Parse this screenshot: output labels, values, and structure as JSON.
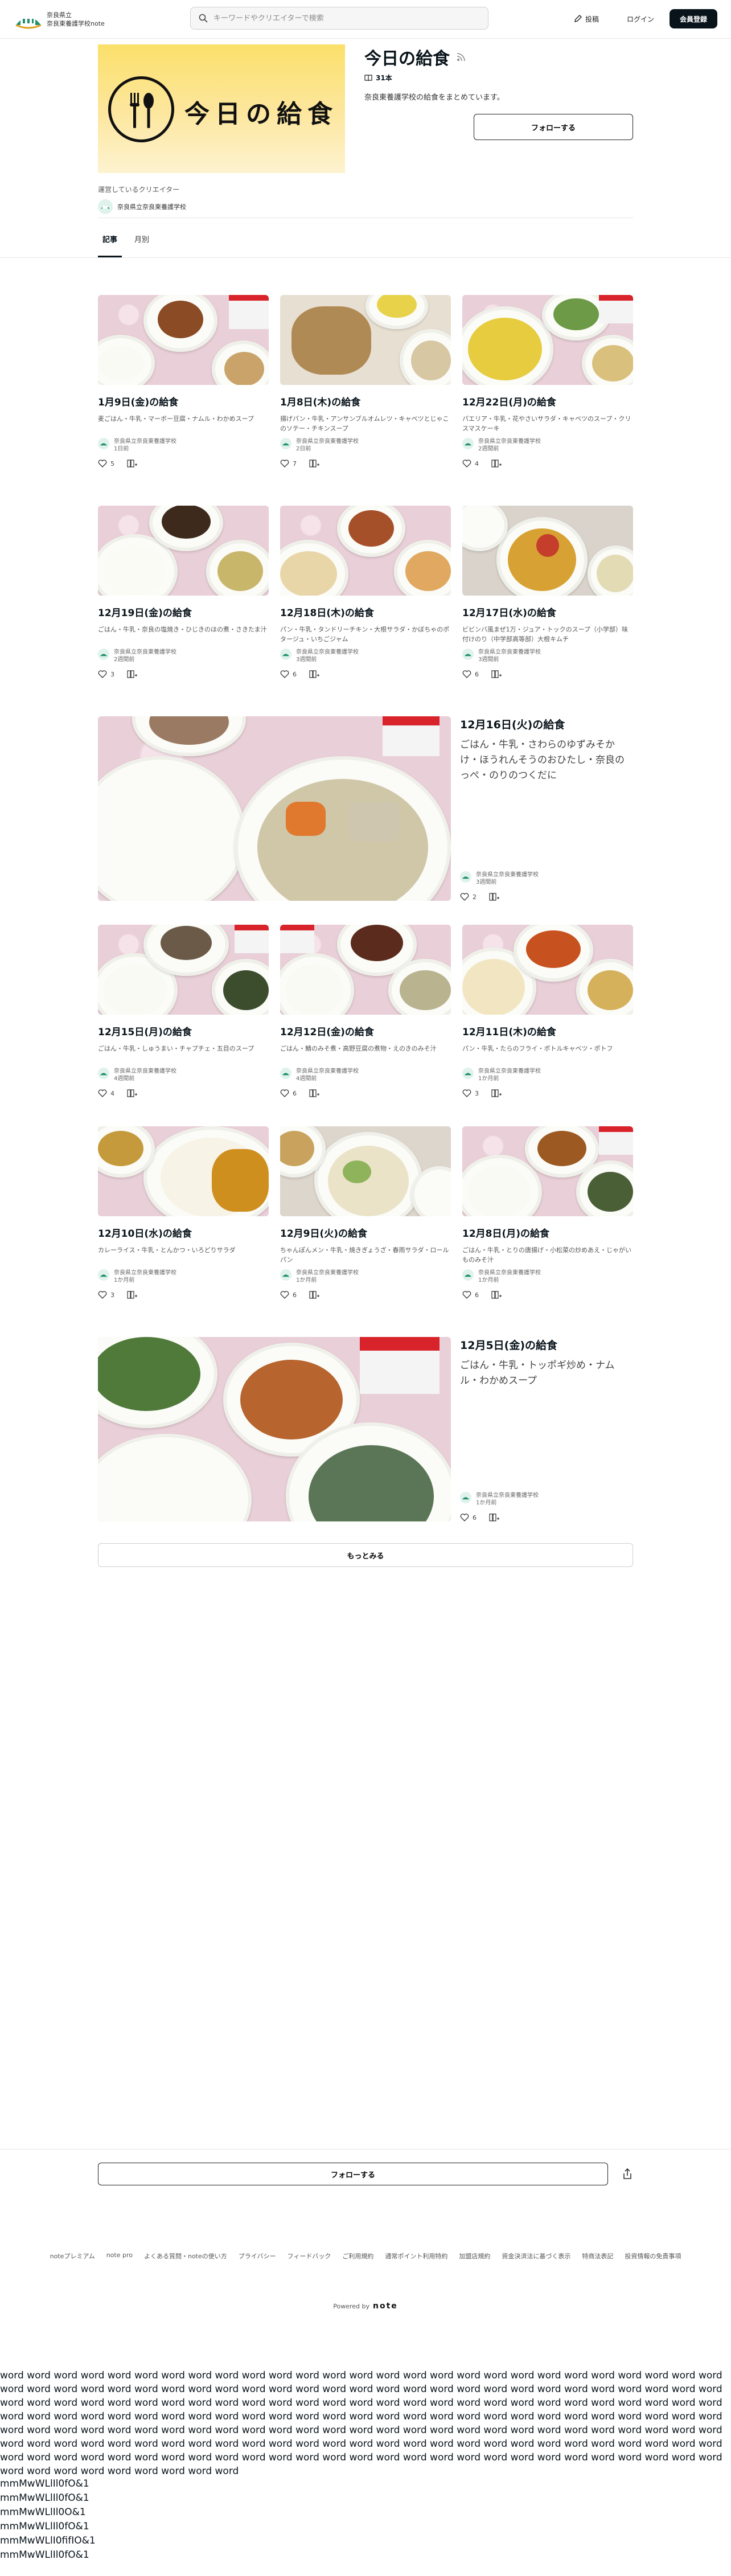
{
  "header": {
    "logo_line1": "奈良県立",
    "logo_line2": "奈良東養護学校note",
    "search_placeholder": "キーワードやクリエイターで検索",
    "post_label": "投稿",
    "login_label": "ログイン",
    "signup_label": "会員登録"
  },
  "magazine": {
    "banner_text": "今日の給食",
    "title": "今日の給食",
    "article_count": "31本",
    "description": "奈良東養護学校の給食をまとめています。",
    "follow_label": "フォローする",
    "operator_label": "運営しているクリエイター",
    "operator_name": "奈良県立奈良東養護学校"
  },
  "tabs": [
    {
      "label": "記事",
      "active": true
    },
    {
      "label": "月別",
      "active": false
    }
  ],
  "articles": [
    {
      "title": "1月9日(金)の給食",
      "desc": "麦ごはん・牛乳・マーボー豆腐・ナムル・わかめスープ",
      "author": "奈良県立奈良東養護学校",
      "time": "1日前",
      "likes": "5"
    },
    {
      "title": "1月8日(木)の給食",
      "desc": "揚げパン・牛乳・アンサンブルオムレツ・キャベツとじゃこのソテー・チキンスープ",
      "author": "奈良県立奈良東養護学校",
      "time": "2日前",
      "likes": "7"
    },
    {
      "title": "12月22日(月)の給食",
      "desc": "パエリア・牛乳・花やさいサラダ・キャベツのスープ・クリスマスケーキ",
      "author": "奈良県立奈良東養護学校",
      "time": "2週間前",
      "likes": "4"
    },
    {
      "title": "12月19日(金)の給食",
      "desc": "ごはん・牛乳・奈良の塩焼き・ひじきのほの煮・さきたま汁",
      "author": "奈良県立奈良東養護学校",
      "time": "2週間前",
      "likes": "3"
    },
    {
      "title": "12月18日(木)の給食",
      "desc": "パン・牛乳・タンドリーチキン・大根サラダ・かぼちゃのポタージュ・いちごジャム",
      "author": "奈良県立奈良東養護学校",
      "time": "3週間前",
      "likes": "6"
    },
    {
      "title": "12月17日(水)の給食",
      "desc": "ビビンバ風まぜ1万・ジュア・トックのスープ（小学部）味付けのり（中学部高等部）大根キムチ",
      "author": "奈良県立奈良東養護学校",
      "time": "3週間前",
      "likes": "6"
    },
    {
      "title": "12月16日(火)の給食",
      "desc": "ごはん・牛乳・さわらのゆずみそかけ・ほうれんそうのおひたし・奈良のっぺ・のりのつくだに",
      "author": "奈良県立奈良東養護学校",
      "time": "3週間前",
      "likes": "2"
    },
    {
      "title": "12月15日(月)の給食",
      "desc": "ごはん・牛乳・しゅうまい・チャプチェ・五目のスープ",
      "author": "奈良県立奈良東養護学校",
      "time": "4週間前",
      "likes": "4"
    },
    {
      "title": "12月12日(金)の給食",
      "desc": "ごはん・鯖のみそ煮・高野豆腐の煮物・えのきのみそ汁",
      "author": "奈良県立奈良東養護学校",
      "time": "4週間前",
      "likes": "6"
    },
    {
      "title": "12月11日(木)の給食",
      "desc": "パン・牛乳・たらのフライ・ポトルキャベツ・ポトフ",
      "author": "奈良県立奈良東養護学校",
      "time": "1か月前",
      "likes": "3"
    },
    {
      "title": "12月10日(水)の給食",
      "desc": "カレーライス・牛乳・とんかつ・いろどりサラダ",
      "author": "奈良県立奈良東養護学校",
      "time": "1か月前",
      "likes": "3"
    },
    {
      "title": "12月9日(火)の給食",
      "desc": "ちゃんぽんメン・牛乳・焼きぎょうざ・春雨サラダ・ロールパン",
      "author": "奈良県立奈良東養護学校",
      "time": "1か月前",
      "likes": "6"
    },
    {
      "title": "12月8日(月)の給食",
      "desc": "ごはん・牛乳・とりの唐揚げ・小松菜の炒めあえ・じゃがいものみそ汁",
      "author": "奈良県立奈良東養護学校",
      "time": "1か月前",
      "likes": "6"
    },
    {
      "title": "12月5日(金)の給食",
      "desc": "ごはん・牛乳・トッポギ炒め・ナムル・わかめスープ",
      "author": "奈良県立奈良東養護学校",
      "time": "1か月前",
      "likes": "6"
    }
  ],
  "more_label": "もっとみる",
  "bottom_follow_label": "フォローする",
  "footer": {
    "links": [
      "noteプレミアム",
      "note pro",
      "よくある質問・noteの使い方",
      "プライバシー",
      "フィードバック",
      "ご利用規約",
      "通常ポイント利用特約",
      "加盟店規約",
      "資金決済法に基づく表示",
      "特商法表記",
      "投資情報の免責事項"
    ],
    "powered_by": "Powered by",
    "powered_brand": "note"
  },
  "filler": {
    "words": "word word word word word word word word word word word word word word word word word word word word word word word word word word word word word word word word word word word word word word word word word word word word word word word word word word word word word word word word word word word word word word word word word word word word word word word word word word word word word word word word word word word word word word word word word word word word word word word word word word word word word word word word word word word word word word word word word word word word word word word word word word word word word word word word word word word word word word word word word word word word word word word word word word word word word word word word word word word word word word word word word word word word word word word word word word word word word word word word word word word word word word word word word word word word word word word word word word word word word word",
    "glyph_lines": [
      "mmMwWLlIl0fO&1",
      "mmMwWLlIl0fO&1",
      "mmMwWLlIl0O&1",
      "mmMwWLlIl0fO&1",
      "mmMwWLlI0fifIO&1",
      "mmMwWLlIl0fO&1"
    ]
  }
}
